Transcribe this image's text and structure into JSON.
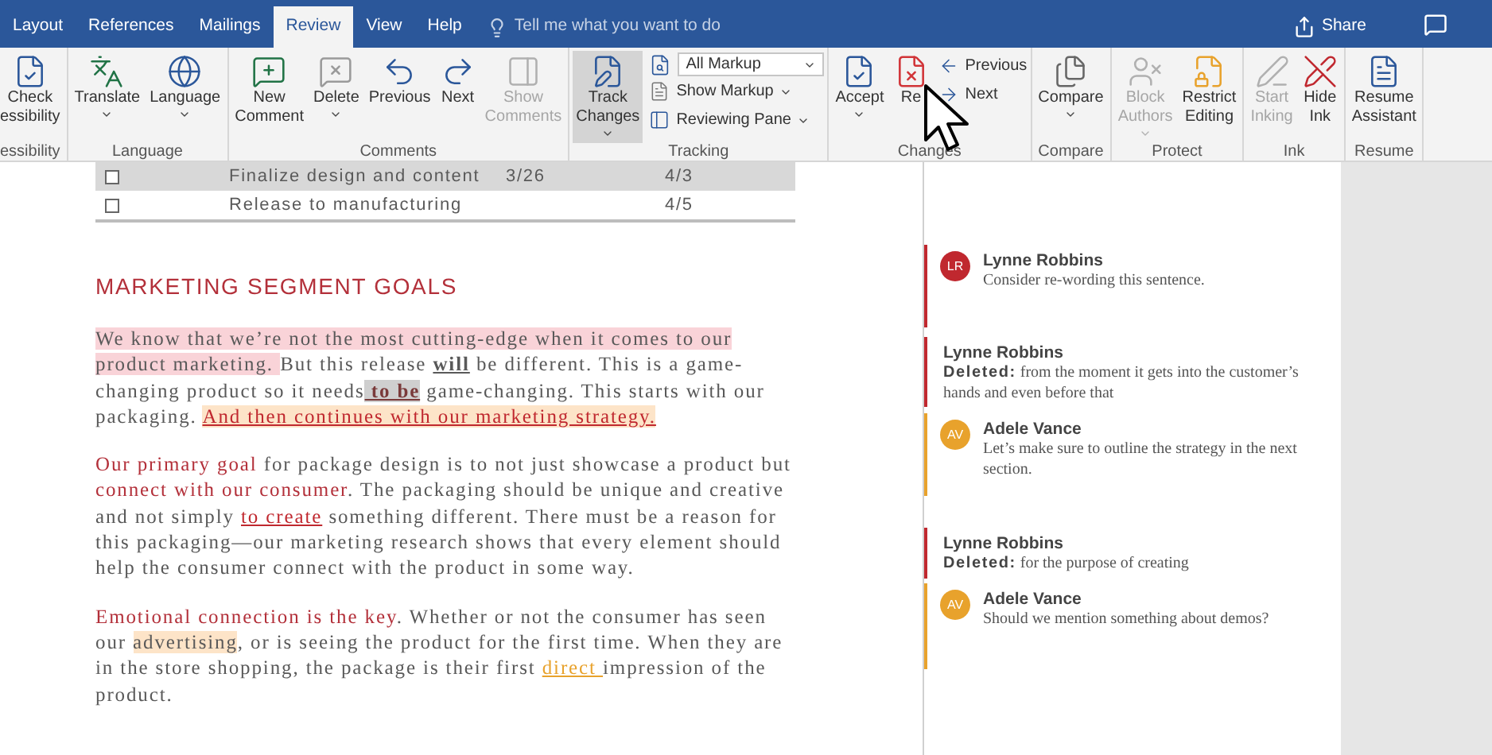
{
  "tabs": [
    {
      "label": "Layout",
      "selected": false
    },
    {
      "label": "References",
      "selected": false
    },
    {
      "label": "Mailings",
      "selected": false
    },
    {
      "label": "Review",
      "selected": true
    },
    {
      "label": "View",
      "selected": false
    },
    {
      "label": "Help",
      "selected": false
    }
  ],
  "tell_me": {
    "placeholder": "Tell me what you want to do"
  },
  "share": "Share",
  "ribbon": {
    "groups": [
      {
        "label": "essibility",
        "buttons": [
          {
            "kind": "large",
            "lines": [
              "Check",
              "essibility"
            ],
            "dropdown": false,
            "disabled": false,
            "pressed": false
          }
        ]
      },
      {
        "label": "Language",
        "buttons": [
          {
            "kind": "large",
            "lines": [
              "Translate"
            ],
            "dropdown": true,
            "disabled": false,
            "pressed": false
          },
          {
            "kind": "large",
            "lines": [
              "Language"
            ],
            "dropdown": true,
            "disabled": false,
            "pressed": false
          }
        ]
      },
      {
        "label": "Comments",
        "buttons": [
          {
            "kind": "large",
            "lines": [
              "New",
              "Comment"
            ],
            "dropdown": false,
            "disabled": false,
            "pressed": false
          },
          {
            "kind": "large",
            "lines": [
              "Delete"
            ],
            "dropdown": true,
            "disabled": false,
            "pressed": false
          },
          {
            "kind": "large",
            "lines": [
              "Previous"
            ],
            "dropdown": false,
            "disabled": false,
            "pressed": false
          },
          {
            "kind": "large",
            "lines": [
              "Next"
            ],
            "dropdown": false,
            "disabled": false,
            "pressed": false
          },
          {
            "kind": "large",
            "lines": [
              "Show",
              "Comments"
            ],
            "dropdown": false,
            "disabled": true,
            "pressed": false
          }
        ]
      },
      {
        "label": "Tracking",
        "buttons": [
          {
            "kind": "large",
            "lines": [
              "Track",
              "Changes"
            ],
            "dropdown": true,
            "disabled": false,
            "pressed": true
          },
          {
            "kind": "select",
            "label": "All Markup",
            "dropdown": true
          },
          {
            "kind": "small",
            "label": "Show Markup",
            "dropdown": true
          },
          {
            "kind": "small",
            "label": "Reviewing Pane",
            "dropdown": true
          }
        ]
      },
      {
        "label": "Changes",
        "buttons": [
          {
            "kind": "large",
            "lines": [
              "Accept"
            ],
            "dropdown": true,
            "disabled": false,
            "pressed": false
          },
          {
            "kind": "large",
            "lines": [
              "Re"
            ],
            "dropdown": false,
            "disabled": false,
            "pressed": false
          },
          {
            "kind": "small",
            "label": "Previous",
            "dropdown": false
          },
          {
            "kind": "small",
            "label": "Next",
            "dropdown": false
          }
        ]
      },
      {
        "label": "Compare",
        "buttons": [
          {
            "kind": "large",
            "lines": [
              "Compare"
            ],
            "dropdown": true,
            "disabled": false,
            "pressed": false
          }
        ]
      },
      {
        "label": "Protect",
        "buttons": [
          {
            "kind": "large",
            "lines": [
              "Block",
              "Authors"
            ],
            "dropdown": true,
            "disabled": true,
            "pressed": false
          },
          {
            "kind": "large",
            "lines": [
              "Restrict",
              "Editing"
            ],
            "dropdown": false,
            "disabled": false,
            "pressed": false
          }
        ]
      },
      {
        "label": "Ink",
        "buttons": [
          {
            "kind": "large",
            "lines": [
              "Start",
              "Inking"
            ],
            "dropdown": false,
            "disabled": true,
            "pressed": false
          },
          {
            "kind": "large",
            "lines": [
              "Hide",
              "Ink"
            ],
            "dropdown": false,
            "disabled": false,
            "pressed": false
          }
        ]
      },
      {
        "label": "Resume",
        "buttons": [
          {
            "kind": "large",
            "lines": [
              "Resume",
              "Assistant"
            ],
            "dropdown": false,
            "disabled": false,
            "pressed": false
          }
        ]
      }
    ]
  },
  "table": {
    "rows": [
      {
        "checked": false,
        "selected": true,
        "task": "Finalize design and content",
        "start": "3/26",
        "due": "4/3"
      },
      {
        "checked": false,
        "selected": false,
        "task": "Release to manufacturing",
        "due": "4/5"
      }
    ]
  },
  "heading": "MARKETING SEGMENT GOALS",
  "paragraphs": [
    {
      "runs": [
        {
          "kind": "commented",
          "text": "We know that we’re not the most cutting-edge when it comes to our product marketing. "
        },
        {
          "kind": "plain",
          "text": "But this release "
        },
        {
          "kind": "bold_underline",
          "text": "will"
        },
        {
          "kind": "plain",
          "text": " be different. This is a game-changing product so it needs"
        },
        {
          "kind": "moved",
          "text": " to be"
        },
        {
          "kind": "plain",
          "text": " game-changing. This starts with our packaging. "
        },
        {
          "kind": "inserted_commented",
          "text": "And then continues with our marketing strategy."
        }
      ]
    },
    {
      "runs": [
        {
          "kind": "emphasis",
          "text": "Our primary goal"
        },
        {
          "kind": "plain",
          "text": " for package design is to not just showcase a product but "
        },
        {
          "kind": "emphasis",
          "text": "connect with our consumer"
        },
        {
          "kind": "plain",
          "text": ". The packaging should be unique and creative and not simply "
        },
        {
          "kind": "inserted",
          "text": "to create"
        },
        {
          "kind": "plain",
          "text": " something different. There must be a reason for this packaging—our marketing research shows that every element should help the consumer connect with the product in some way."
        }
      ]
    },
    {
      "runs": [
        {
          "kind": "emphasis",
          "text": "Emotional connection is the key"
        },
        {
          "kind": "plain",
          "text": ". Whether or not the consumer has seen our "
        },
        {
          "kind": "commented_amber",
          "text": "advertising"
        },
        {
          "kind": "plain",
          "text": ", or is seeing the product for the first time. When they are in the store shopping, the package is their first "
        },
        {
          "kind": "inserted_amber",
          "text": "direct "
        },
        {
          "kind": "plain",
          "text": "impression of the product."
        }
      ]
    }
  ],
  "markup": [
    {
      "kind": "comment",
      "initials": "LR",
      "author": "Lynne Robbins",
      "text": "Consider re-wording this sentence.",
      "color": "#c0282f"
    },
    {
      "kind": "deletion",
      "author": "Lynne Robbins",
      "label": "Deleted:",
      "text": "from the moment it gets into the customer’s hands and even before that",
      "color": "#c0282f"
    },
    {
      "kind": "comment",
      "initials": "AV",
      "author": "Adele Vance",
      "text": "Let’s make sure to outline the strategy in the next section.",
      "color": "#e8a22c"
    },
    {
      "kind": "deletion",
      "author": "Lynne Robbins",
      "label": "Deleted:",
      "text": "for the purpose of creating",
      "color": "#c0282f"
    },
    {
      "kind": "comment",
      "initials": "AV",
      "author": "Adele Vance",
      "text": "Should we mention something about demos?",
      "color": "#e8a22c"
    }
  ]
}
